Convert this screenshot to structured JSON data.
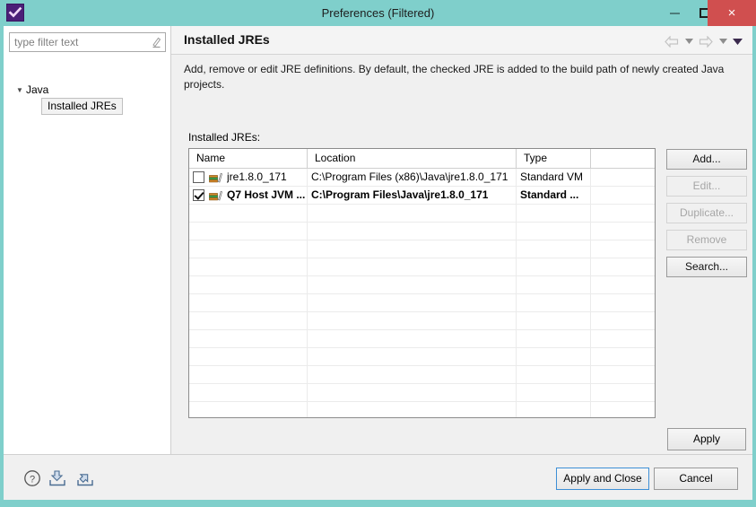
{
  "window": {
    "title": "Preferences (Filtered)",
    "app_icon": "checkmark-icon",
    "titlebar_color": "#7fcfcb",
    "close_button_color": "#d04f4f",
    "controls": {
      "minimize": "minimize-icon",
      "maximize": "maximize-icon",
      "close": "×"
    }
  },
  "filter": {
    "placeholder": "type filter text",
    "value": "",
    "clear_icon": "clear-filter-icon"
  },
  "tree": {
    "items": [
      {
        "label": "Java",
        "expanded": true,
        "selected": false
      },
      {
        "label": "Installed JREs",
        "expanded": false,
        "selected": true
      }
    ]
  },
  "page": {
    "title": "Installed JREs",
    "description": "Add, remove or edit JRE definitions. By default, the checked JRE is added to the build path of newly created Java projects.",
    "table_label": "Installed JREs:"
  },
  "nav": {
    "back": "back-arrow-icon",
    "back_menu": "chevron-down-icon",
    "forward": "forward-arrow-icon",
    "forward_menu": "chevron-down-icon",
    "view_menu": "chevron-down-icon"
  },
  "table": {
    "columns": [
      "Name",
      "Location",
      "Type",
      ""
    ],
    "rows": [
      {
        "checked": false,
        "bold": false,
        "name": "jre1.8.0_171",
        "location": "C:\\Program Files (x86)\\Java\\jre1.8.0_171",
        "type": "Standard VM",
        "extra": ""
      },
      {
        "checked": true,
        "bold": true,
        "name": "Q7 Host JVM ...",
        "location": "C:\\Program Files\\Java\\jre1.8.0_171",
        "type": "Standard ...",
        "extra": ""
      }
    ],
    "empty_row_count": 12
  },
  "buttons": {
    "add": {
      "label": "Add...",
      "enabled": true
    },
    "edit": {
      "label": "Edit...",
      "enabled": false
    },
    "duplicate": {
      "label": "Duplicate...",
      "enabled": false
    },
    "remove": {
      "label": "Remove",
      "enabled": false
    },
    "search": {
      "label": "Search...",
      "enabled": true
    },
    "apply": {
      "label": "Apply",
      "enabled": true
    },
    "apply_and_close": {
      "label": "Apply and Close",
      "enabled": true,
      "focused": true,
      "focus_color": "#3d8fd6"
    },
    "cancel": {
      "label": "Cancel",
      "enabled": true
    }
  },
  "footer": {
    "help_icon": "help-icon",
    "import_icon": "import-icon",
    "export_icon": "export-icon"
  }
}
